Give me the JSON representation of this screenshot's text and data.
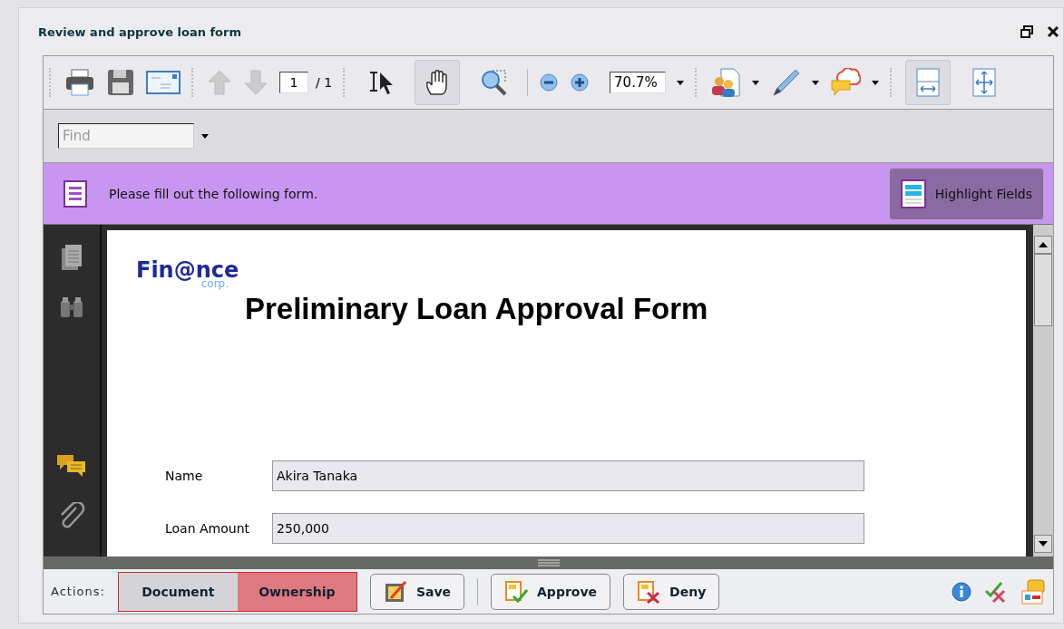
{
  "window": {
    "title": "Review and approve loan form"
  },
  "toolbar": {
    "page_current": "1",
    "page_total": "/ 1",
    "zoom": "70.7%",
    "tools": [
      {
        "kind": "select",
        "selected": false
      },
      {
        "kind": "hand",
        "selected": true
      },
      {
        "kind": "zoom",
        "selected": false
      }
    ],
    "view_modes": [
      {
        "kind": "fit-width",
        "selected": true
      },
      {
        "kind": "fit-page",
        "selected": false
      }
    ]
  },
  "find": {
    "placeholder": "Find"
  },
  "banner": {
    "message": "Please fill out the following form.",
    "button": "Highlight Fields"
  },
  "document": {
    "logo": "Fin@nce",
    "logo_sub": "corp.",
    "title": "Preliminary Loan Approval Form",
    "fields": [
      {
        "label": "Name",
        "value": "Akira Tanaka"
      },
      {
        "label": "Loan Amount",
        "value": "250,000"
      }
    ]
  },
  "actions": {
    "label": "Actions:",
    "tabs": [
      {
        "label": "Document",
        "selected": false
      },
      {
        "label": "Ownership",
        "selected": true
      }
    ],
    "buttons": [
      {
        "kind": "save",
        "label": "Save"
      },
      {
        "kind": "approve",
        "label": "Approve"
      },
      {
        "kind": "deny",
        "label": "Deny"
      }
    ]
  }
}
